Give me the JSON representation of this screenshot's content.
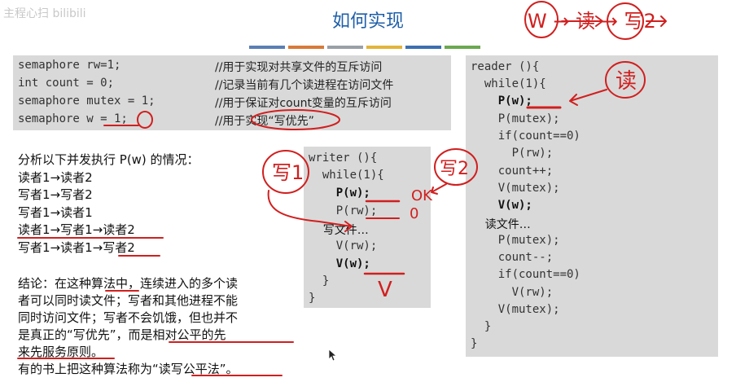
{
  "watermark": "主程心扫 bilibili",
  "title": "如何实现",
  "color_bar": [
    "#5b7fb5",
    "#d87a3a",
    "#9aa0a6",
    "#e2b43a",
    "#3d6fb0",
    "#6aa84f"
  ],
  "semaphores": [
    {
      "code": "semaphore rw=1;",
      "comment": "//用于实现对共享文件的互斥访问"
    },
    {
      "code": "int count = 0;",
      "comment": "//记录当前有几个读进程在访问文件"
    },
    {
      "code": "semaphore mutex = 1;",
      "comment": "//用于保证对count变量的互斥访问"
    },
    {
      "code": "semaphore w = 1;",
      "comment": "//用于实现“写优先”"
    }
  ],
  "analysis": {
    "heading": "分析以下并发执行 P(w) 的情况：",
    "cases": [
      "读者1→读者2",
      "写者1→写者2",
      "写者1→读者1",
      "读者1→写者1→读者2",
      "写者1→读者1→写者2"
    ]
  },
  "conclusion": {
    "lines": [
      "结论：在这种算法中，连续进入的多个读",
      "者可以同时读文件；写者和其他进程不能",
      "同时访问文件；写者不会饥饿，但也并不",
      "是真正的“写优先”，而是相对公平的先",
      "来先服务原则。",
      "有的书上把这种算法称为“读写公平法”。"
    ]
  },
  "writer": {
    "lines": [
      "writer (){",
      "  while(1){",
      "    P(w);",
      "    P(rw);",
      "    写文件…",
      "    V(rw);",
      "    V(w);",
      "  }",
      "}"
    ]
  },
  "reader": {
    "lines": [
      "reader (){",
      "  while(1){",
      "    P(w);",
      "    P(mutex);",
      "    if(count==0)",
      "      P(rw);",
      "    count++;",
      "    V(mutex);",
      "    V(w);",
      "    读文件…",
      "    P(mutex);",
      "    count--;",
      "    if(count==0)",
      "      V(rw);",
      "    V(mutex);",
      "  }",
      "}"
    ]
  },
  "annotations": {
    "top_right": "W → 读 → 写2",
    "reader_mark": "读",
    "writer_left": "写1",
    "writer_right": "写2",
    "ok": "OK",
    "zero": "0",
    "v_mark": "V"
  },
  "ink_color": "#d11f1f"
}
